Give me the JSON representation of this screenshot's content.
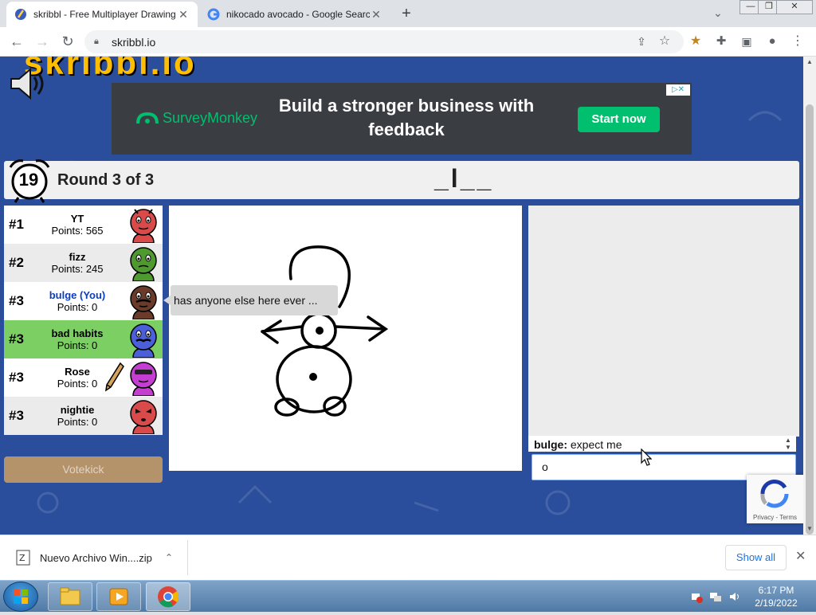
{
  "browser": {
    "tabs": [
      {
        "title": "skribbl - Free Multiplayer Drawing",
        "active": true
      },
      {
        "title": "nikocado avocado - Google Search",
        "active": false
      }
    ],
    "new_tab": "+",
    "url": "skribbl.io",
    "window_controls": {
      "minimize": "—",
      "restore": "❐",
      "close": "✕"
    }
  },
  "ad": {
    "brand": "SurveyMonkey",
    "headline": "Build a stronger business with feedback",
    "cta": "Start now",
    "adchoices": "▷✕"
  },
  "game": {
    "timer": "19",
    "round": "Round 3 of 3",
    "word_hint": "_l__",
    "players": [
      {
        "rank": "#1",
        "name": "YT",
        "points": "Points: 565",
        "avatar_color": "#d94a4a",
        "row": "light",
        "is_you": false,
        "drawing": false
      },
      {
        "rank": "#2",
        "name": "fizz",
        "points": "Points: 245",
        "avatar_color": "#4f9a2e",
        "row": "dark",
        "is_you": false,
        "drawing": false
      },
      {
        "rank": "#3",
        "name": "bulge (You)",
        "points": "Points: 0",
        "avatar_color": "#6b3b2a",
        "row": "light",
        "is_you": true,
        "drawing": false
      },
      {
        "rank": "#3",
        "name": "bad habits",
        "points": "Points: 0",
        "avatar_color": "#4a5fd9",
        "row": "guessed",
        "is_you": false,
        "drawing": false
      },
      {
        "rank": "#3",
        "name": "Rose",
        "points": "Points: 0",
        "avatar_color": "#c43fd1",
        "row": "light",
        "is_you": false,
        "drawing": true
      },
      {
        "rank": "#3",
        "name": "nightie",
        "points": "Points: 0",
        "avatar_color": "#d94a4a",
        "row": "dark",
        "is_you": false,
        "drawing": false
      }
    ],
    "votekick": "Votekick",
    "speech_bubble": "has anyone else here ever ...",
    "chat": {
      "last_message_author": "bulge:",
      "last_message_text": "expect me",
      "input_value": "o"
    },
    "recaptcha_terms": "Privacy - Terms"
  },
  "downloads": {
    "file": "Nuevo Archivo Win....zip",
    "show_all": "Show all"
  },
  "taskbar": {
    "time": "6:17 PM",
    "date": "2/19/2022"
  },
  "colors": {
    "page_bg": "#2a4d9c",
    "guessed_row": "#7ccf63",
    "cta": "#00bf6f",
    "you_name": "#0b3cc2"
  }
}
